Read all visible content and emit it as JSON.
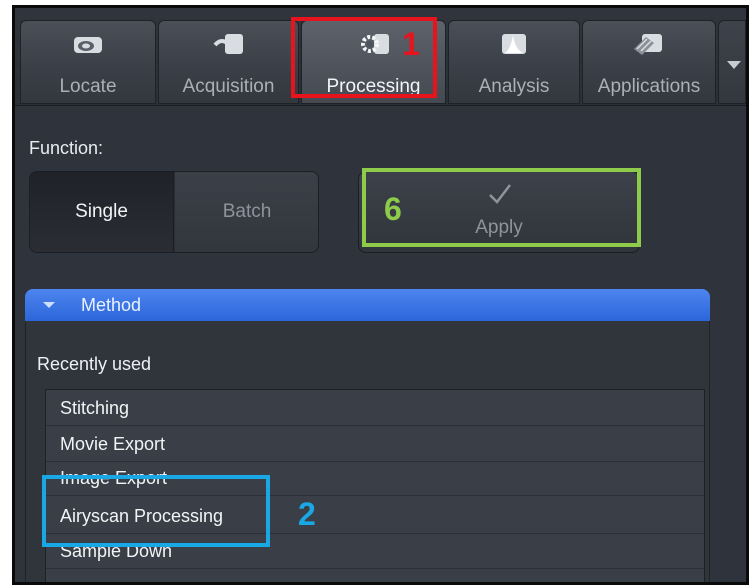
{
  "tabs": [
    {
      "label": "Locate",
      "icon": "locate-icon",
      "active": false
    },
    {
      "label": "Acquisition",
      "icon": "acquisition-icon",
      "active": false
    },
    {
      "label": "Processing",
      "icon": "gear-icon",
      "active": true
    },
    {
      "label": "Analysis",
      "icon": "analysis-icon",
      "active": false
    },
    {
      "label": "Applications",
      "icon": "applications-icon",
      "active": false
    }
  ],
  "function": {
    "label": "Function:",
    "options": [
      "Single",
      "Batch"
    ],
    "selected": "Single",
    "apply_label": "Apply"
  },
  "method": {
    "header": "Method",
    "recent_label": "Recently used",
    "items": [
      "Stitching",
      "Movie Export",
      "Image Export",
      "Airyscan Processing",
      "Sample Down"
    ]
  },
  "annotations": [
    {
      "number": "1",
      "color": "#e8141d"
    },
    {
      "number": "6",
      "color": "#8fcb4a"
    },
    {
      "number": "2",
      "color": "#1aa7e6"
    }
  ],
  "colors": {
    "accent": "#2d66d8",
    "background": "#2f333b"
  }
}
